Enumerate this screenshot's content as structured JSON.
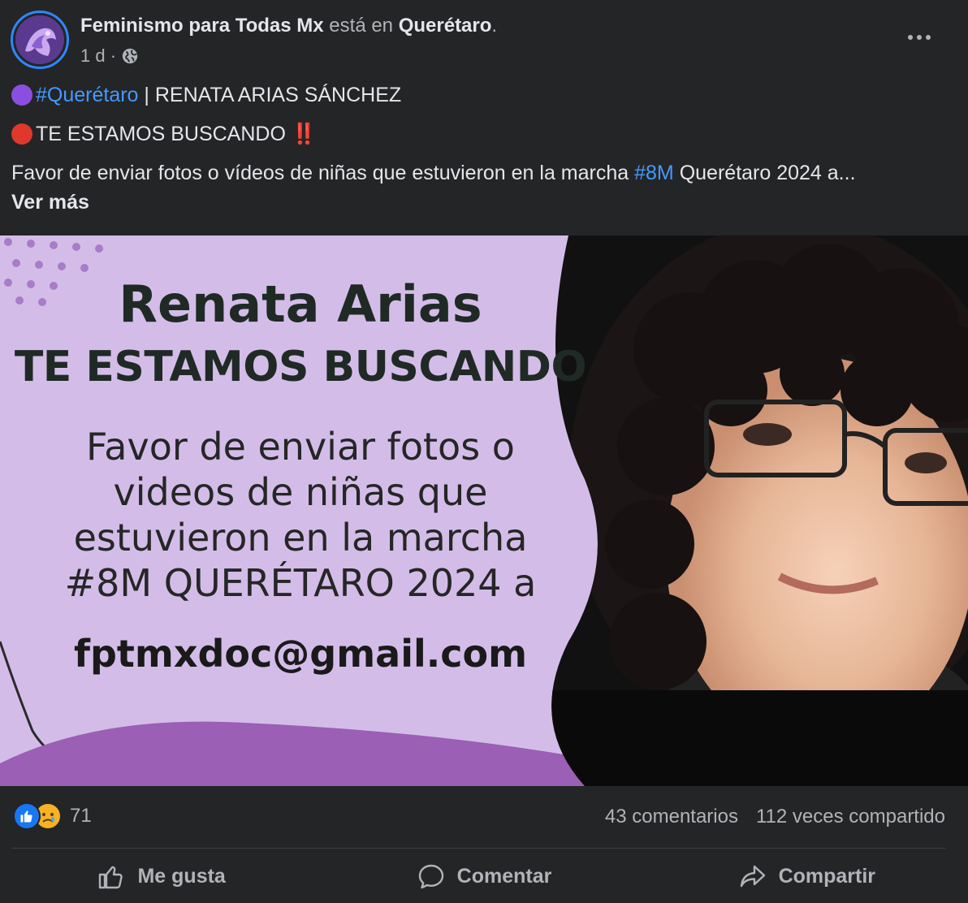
{
  "post": {
    "page_name": "Feminismo para Todas Mx",
    "location_prefix": "está en",
    "location": "Querétaro",
    "location_suffix": ".",
    "time": "1 d ·",
    "privacy_icon": "globe-icon",
    "more_icon": "more-horizontal-icon"
  },
  "body": {
    "line1_hashtag": "#Querétaro",
    "line1_rest": " | RENATA ARIAS SÁNCHEZ",
    "line2_text": "TE ESTAMOS BUSCANDO ",
    "line2_emoji": "‼️",
    "line3_before": "Favor de enviar fotos o vídeos de niñas que estuvieron en la marcha ",
    "line3_hashtag": "#8M",
    "line3_after": " Querétaro 2024 a...",
    "see_more": "Ver más"
  },
  "image": {
    "title": "Renata Arias",
    "subtitle": "TE ESTAMOS BUSCANDO",
    "para_line1": "Favor de enviar fotos o",
    "para_line2": "videos de niñas que",
    "para_line3": "estuvieron en la marcha",
    "para_line4": "#8M QUERÉTARO 2024 a",
    "email": "fptmxdoc@gmail.com"
  },
  "stats": {
    "reaction_count": "71",
    "comments": "43 comentarios",
    "shares": "112 veces compartido"
  },
  "actions": {
    "like": "Me gusta",
    "comment": "Comentar",
    "share": "Compartir"
  },
  "colors": {
    "background": "#242526",
    "link": "#4599ff",
    "image_bg": "#d3bde8",
    "image_wave": "#9b5fb5",
    "like_blue": "#1877f2"
  }
}
